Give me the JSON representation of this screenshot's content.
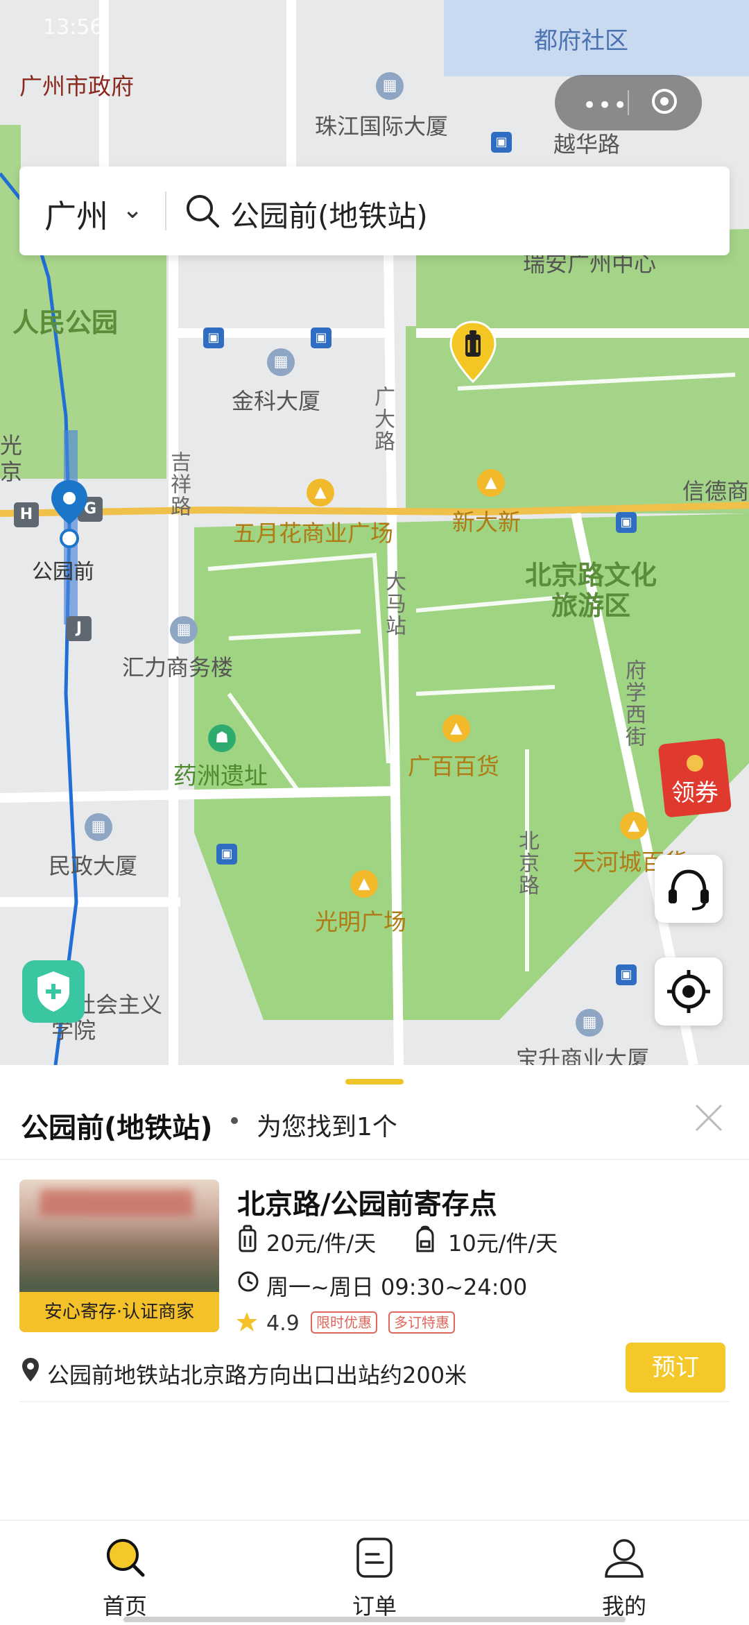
{
  "status_bar": {
    "time": "13:56"
  },
  "capsule": {
    "more_icon": "more-dots-icon",
    "close_icon": "target-circle-icon"
  },
  "search": {
    "city": "广州",
    "query": "公园前(地铁站)"
  },
  "map": {
    "labels": {
      "district_renmin": "人民公园",
      "gov": "广州市政府",
      "zhujiang": "珠江国际大厦",
      "yuehua": "越华路",
      "dufu": "都府社区",
      "ruian": "瑞安广州中心",
      "jinke": "金科大厦",
      "guangda": "广大路",
      "jixiang": "吉祥路",
      "xindexiang": "信德商",
      "wuyuehua": "五月花商业广场",
      "xindaxin": "新大新",
      "beijinglu_district": "北京路文化旅游区",
      "damazhan": "大马站",
      "huili": "汇力商务楼",
      "fuxuexi": "府学西街",
      "yaozhou": "药洲遗址",
      "guangbai": "广百百货",
      "beijinglu": "北京路",
      "tianhe": "天河城百货",
      "minzheng": "民政大厦",
      "guangming": "光明广场",
      "shehui": "市社会主义学院",
      "baosheng": "宝升商业大厦",
      "station": "公园前",
      "exit_h": "H",
      "exit_g": "G",
      "exit_j": "J",
      "guang": "光",
      "jing": "京"
    }
  },
  "coupon": {
    "label": "领券"
  },
  "sheet": {
    "title": "公园前(地铁站)",
    "count": "为您找到1个",
    "store": {
      "name": "北京路/公园前寄存点",
      "price_luggage": "20元/件/天",
      "price_bag": "10元/件/天",
      "hours": "周一~周日 09:30~24:00",
      "rating": "4.9",
      "tags": [
        "限时优惠",
        "多订特惠"
      ],
      "badge": "安心寄存·认证商家",
      "address": "公园前地铁站北京路方向出口出站约200米",
      "book": "预订"
    }
  },
  "tabs": [
    {
      "label": "首页",
      "icon": "search-icon"
    },
    {
      "label": "订单",
      "icon": "order-icon"
    },
    {
      "label": "我的",
      "icon": "profile-icon"
    }
  ],
  "colors": {
    "accent": "#F5C829",
    "map_green": "#9fd483",
    "road": "#ffffff",
    "subway_line": "#1f6fd6",
    "main_road": "#f0c14a"
  }
}
